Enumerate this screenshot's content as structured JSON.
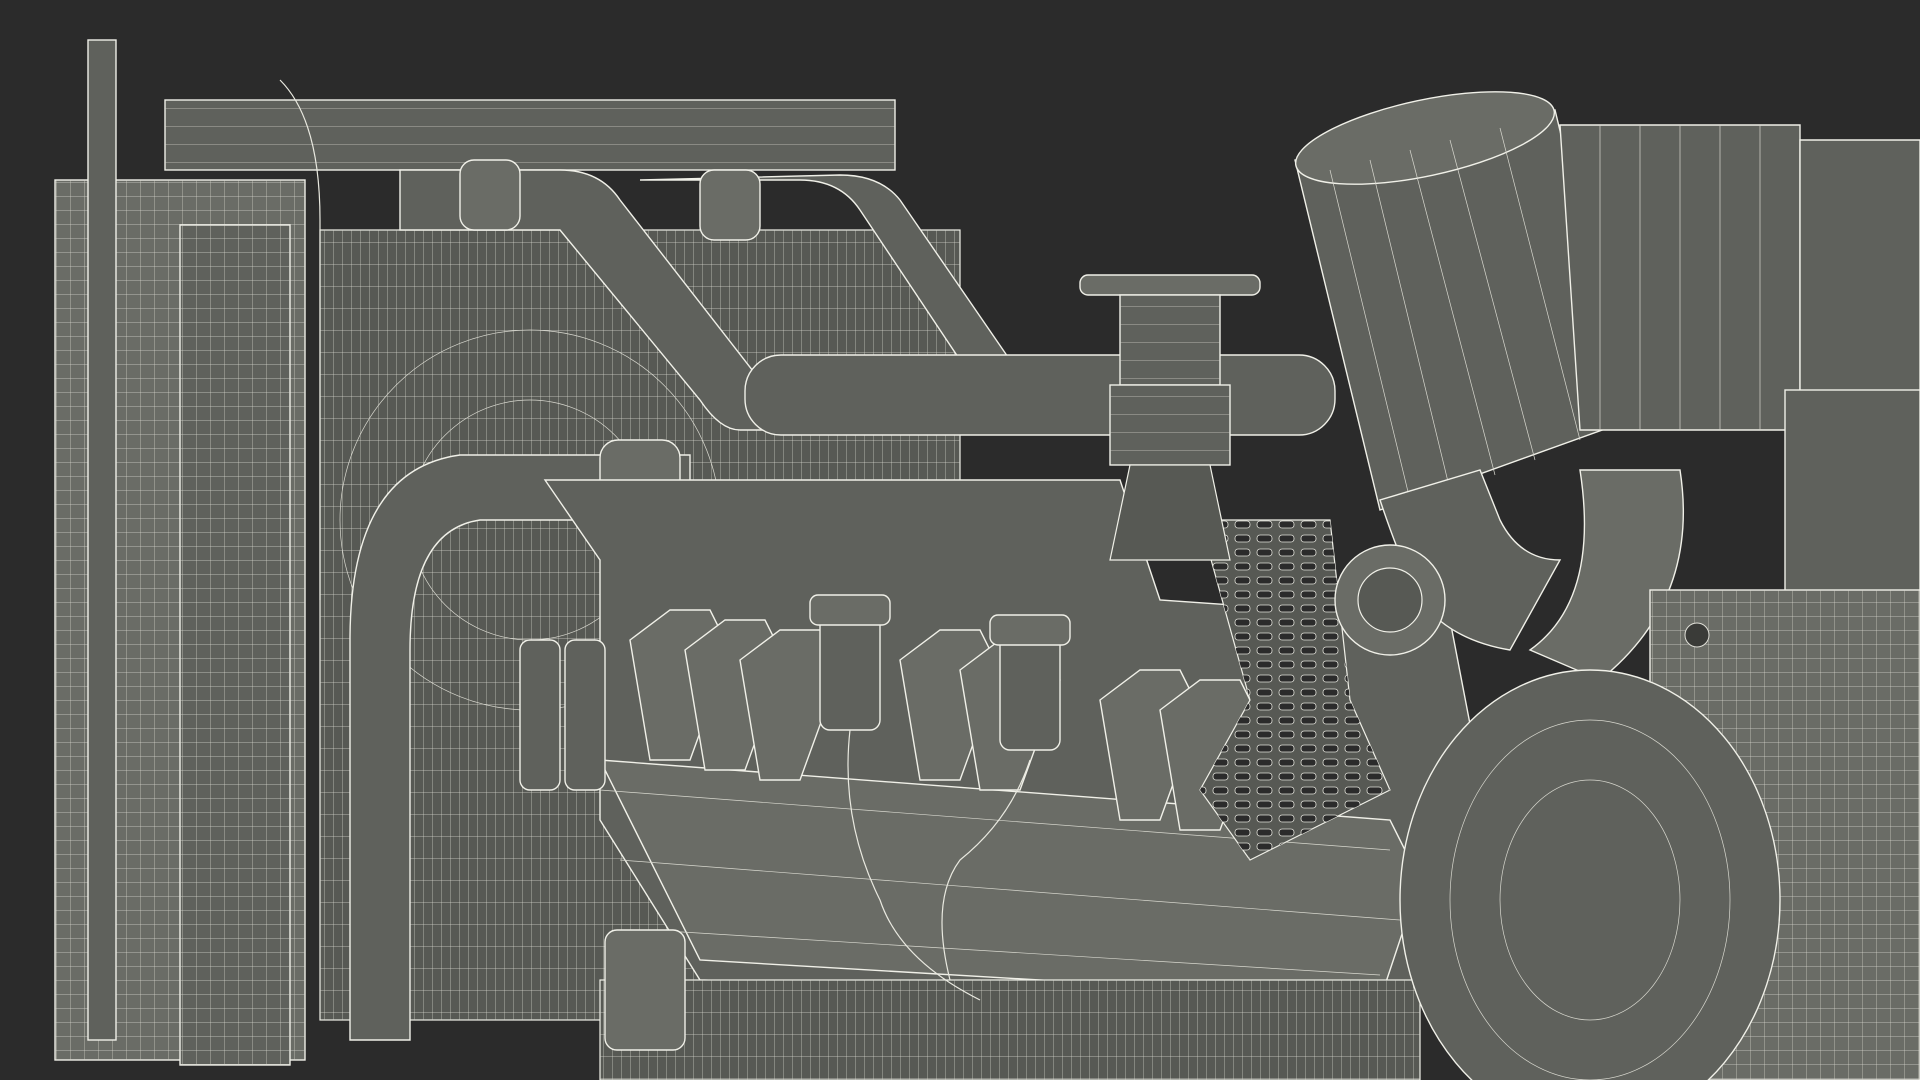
{
  "scene": {
    "background": "#2b2b2b",
    "surface": "#5f615c",
    "wire": "#e9e9e0"
  }
}
